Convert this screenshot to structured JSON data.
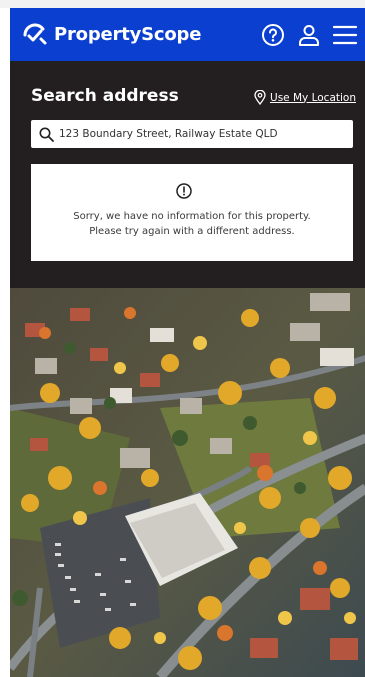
{
  "header": {
    "brand": "PropertyScope",
    "icons": [
      "help-icon",
      "user-icon",
      "menu-icon"
    ]
  },
  "search": {
    "title": "Search address",
    "location_link": "Use My Location",
    "value": "123 Boundary Street, Railway Estate QLD"
  },
  "message": {
    "line1": "Sorry, we have no information for this property.",
    "line2": "Please try again with a different address."
  },
  "colors": {
    "brand": "#0b3fd0",
    "panel": "#231f20"
  }
}
